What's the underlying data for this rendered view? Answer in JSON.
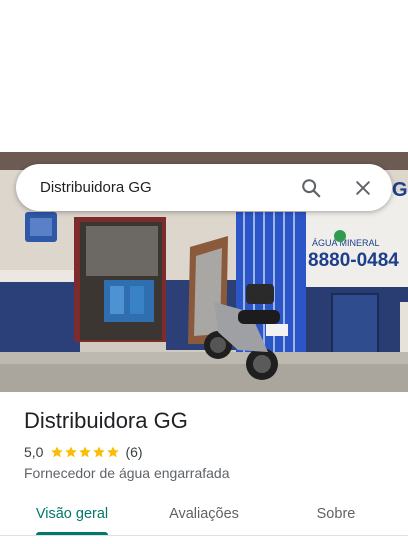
{
  "search": {
    "query": "Distribuidora GG"
  },
  "photo": {
    "sign_text_water": "ÁGUA MINERAL",
    "sign_text_phone": "8880-0484",
    "sign_text_g": "G."
  },
  "place": {
    "name": "Distribuidora GG",
    "rating": "5,0",
    "rating_value": 5,
    "review_count": "(6)",
    "category": "Fornecedor de água engarrafada"
  },
  "tabs": [
    {
      "label": "Visão geral",
      "active": true
    },
    {
      "label": "Avaliações",
      "active": false
    },
    {
      "label": "Sobre",
      "active": false
    }
  ],
  "colors": {
    "accent": "#00796b",
    "star": "#fbbc04"
  }
}
